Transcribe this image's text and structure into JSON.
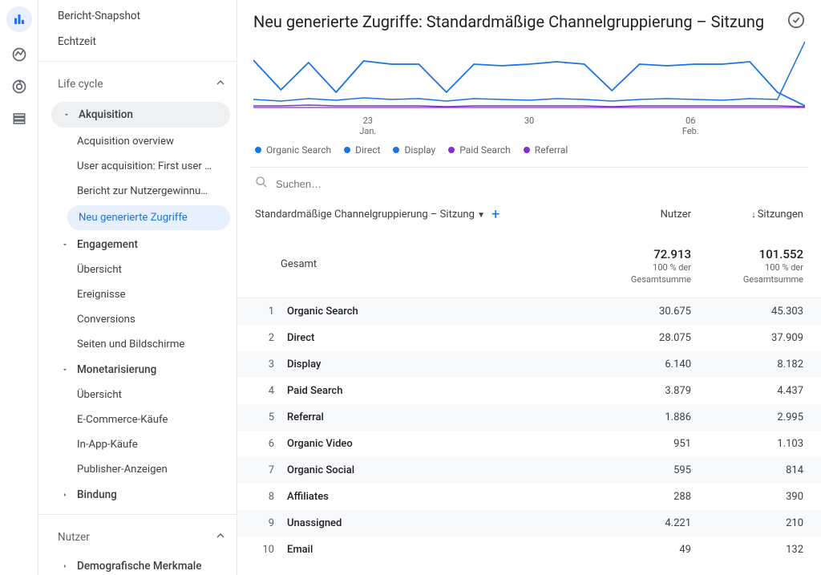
{
  "sidebar": {
    "top_items": [
      "Bericht-Snapshot",
      "Echtzeit"
    ],
    "sections": [
      {
        "label": "Life cycle",
        "groups": [
          {
            "label": "Akquisition",
            "selected": true,
            "subs": [
              {
                "label": "Acquisition overview"
              },
              {
                "label": "User acquisition: First user …"
              },
              {
                "label": "Bericht zur Nutzergewinnu…"
              },
              {
                "label": "Neu generierte Zugriffe",
                "active": true
              }
            ]
          },
          {
            "label": "Engagement",
            "subs": [
              {
                "label": "Übersicht"
              },
              {
                "label": "Ereignisse"
              },
              {
                "label": "Conversions"
              },
              {
                "label": "Seiten und Bildschirme"
              }
            ]
          },
          {
            "label": "Monetarisierung",
            "subs": [
              {
                "label": "Übersicht"
              },
              {
                "label": "E-Commerce-Käufe"
              },
              {
                "label": "In-App-Käufe"
              },
              {
                "label": "Publisher-Anzeigen"
              }
            ]
          },
          {
            "label": "Bindung",
            "subs": []
          }
        ]
      },
      {
        "label": "Nutzer",
        "groups": [
          {
            "label": "Demografische Merkmale",
            "subs": []
          }
        ]
      }
    ]
  },
  "main": {
    "title": "Neu generierte Zugriffe: Standardmäßige Channelgruppierung – Sitzung",
    "x_ticks": [
      {
        "top": "23",
        "bottom": "Jan."
      },
      {
        "top": "30",
        "bottom": ""
      },
      {
        "top": "06",
        "bottom": "Feb."
      }
    ],
    "legend": [
      {
        "label": "Organic Search",
        "color": "#1a73e8"
      },
      {
        "label": "Direct",
        "color": "#1a73e8"
      },
      {
        "label": "Display",
        "color": "#1a73e8"
      },
      {
        "label": "Paid Search",
        "color": "#8430ce"
      },
      {
        "label": "Referral",
        "color": "#8430ce"
      }
    ],
    "search_placeholder": "Suchen…",
    "dimension_label": "Standardmäßige Channelgruppierung – Sitzung",
    "columns": {
      "users": "Nutzer",
      "sessions": "Sitzungen"
    },
    "totals_label": "Gesamt",
    "totals": {
      "users": {
        "value": "72.913",
        "sub1": "100 % der",
        "sub2": "Gesamtsumme"
      },
      "sessions": {
        "value": "101.552",
        "sub1": "100 % der",
        "sub2": "Gesamtsumme"
      }
    },
    "rows": [
      {
        "n": "1",
        "label": "Organic Search",
        "users": "30.675",
        "sessions": "45.303"
      },
      {
        "n": "2",
        "label": "Direct",
        "users": "28.075",
        "sessions": "37.909"
      },
      {
        "n": "3",
        "label": "Display",
        "users": "6.140",
        "sessions": "8.182"
      },
      {
        "n": "4",
        "label": "Paid Search",
        "users": "3.879",
        "sessions": "4.437"
      },
      {
        "n": "5",
        "label": "Referral",
        "users": "1.886",
        "sessions": "2.995"
      },
      {
        "n": "6",
        "label": "Organic Video",
        "users": "951",
        "sessions": "1.103"
      },
      {
        "n": "7",
        "label": "Organic Social",
        "users": "595",
        "sessions": "814"
      },
      {
        "n": "8",
        "label": "Affiliates",
        "users": "288",
        "sessions": "390"
      },
      {
        "n": "9",
        "label": "Unassigned",
        "users": "4.221",
        "sessions": "210"
      },
      {
        "n": "10",
        "label": "Email",
        "users": "49",
        "sessions": "132"
      }
    ]
  },
  "chart_data": {
    "type": "line",
    "title": "Neu generierte Zugriffe",
    "xlabel": "",
    "ylabel": "",
    "x_ticks": [
      "23 Jan.",
      "30",
      "06 Feb."
    ],
    "series": [
      {
        "name": "Organic Search",
        "color": "#1a73e8",
        "values_approx": [
          1900,
          900,
          1700,
          800,
          1800,
          1700,
          1700,
          800,
          1700,
          1600,
          1700,
          1800,
          1700,
          900,
          1700,
          1600,
          1700,
          1700,
          1800,
          800,
          200
        ]
      },
      {
        "name": "Direct",
        "color": "#1a73e8",
        "values_approx": [
          400,
          350,
          420,
          380,
          450,
          400,
          420,
          350,
          430,
          400,
          380,
          420,
          400,
          350,
          400,
          420,
          400,
          380,
          420,
          400,
          2600
        ]
      },
      {
        "name": "Display",
        "color": "#1a73e8",
        "values_approx": [
          200,
          180,
          220,
          200,
          210,
          200,
          190,
          180,
          210,
          200,
          200,
          210,
          200,
          180,
          200,
          210,
          200,
          190,
          200,
          200,
          180
        ]
      },
      {
        "name": "Paid Search",
        "color": "#8430ce",
        "values_approx": [
          150,
          140,
          160,
          150,
          155,
          150,
          145,
          140,
          155,
          150,
          150,
          155,
          150,
          140,
          150,
          155,
          150,
          145,
          150,
          150,
          140
        ]
      },
      {
        "name": "Referral",
        "color": "#8430ce",
        "values_approx": [
          100,
          90,
          110,
          100,
          105,
          100,
          95,
          90,
          105,
          100,
          100,
          105,
          100,
          90,
          100,
          105,
          100,
          95,
          100,
          100,
          90
        ]
      }
    ]
  }
}
